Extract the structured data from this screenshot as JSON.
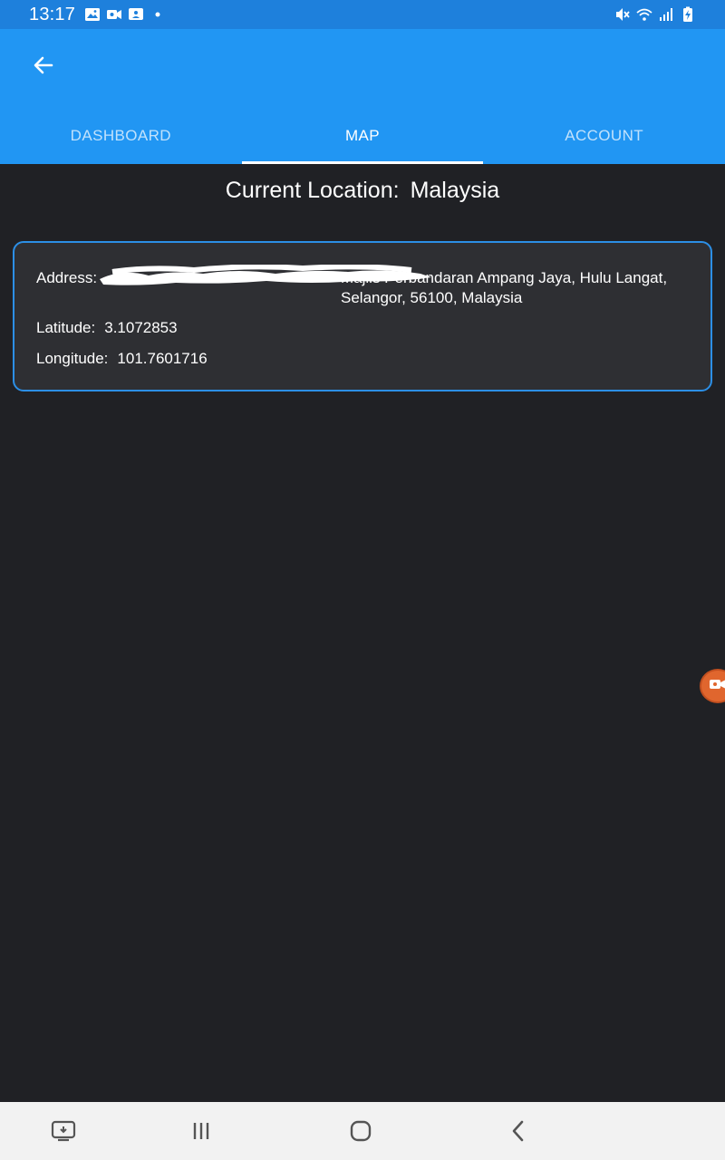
{
  "status_bar": {
    "time": "13:17",
    "icons_left": [
      "gallery-icon",
      "video-icon",
      "screen-icon",
      "dot-icon"
    ],
    "icons_right": [
      "mute-icon",
      "wifi-icon",
      "signal-icon",
      "battery-icon"
    ],
    "color": "#1e80dc"
  },
  "app_bar": {
    "back_icon": "arrow-left-icon",
    "color": "#2196f3",
    "tabs": [
      {
        "label": "DASHBOARD",
        "active": false
      },
      {
        "label": "MAP",
        "active": true
      },
      {
        "label": "ACCOUNT",
        "active": false
      }
    ]
  },
  "location": {
    "label": "Current Location:",
    "country": "Malaysia"
  },
  "card": {
    "address_label": "Address:",
    "address_value": "Majlis Perbandaran Ampang Jaya, Hulu Langat, Selangor, 56100, Malaysia",
    "latitude_label": "Latitude:",
    "latitude_value": "3.1072853",
    "longitude_label": "Longitude:",
    "longitude_value": "101.7601716",
    "border_color": "#2c8fe6"
  },
  "floating_button": {
    "icon": "video-record-icon",
    "color": "#e0662e"
  },
  "nav_bar": {
    "buttons": [
      "screen-mirror-icon",
      "recents-icon",
      "home-icon",
      "back-icon"
    ]
  }
}
